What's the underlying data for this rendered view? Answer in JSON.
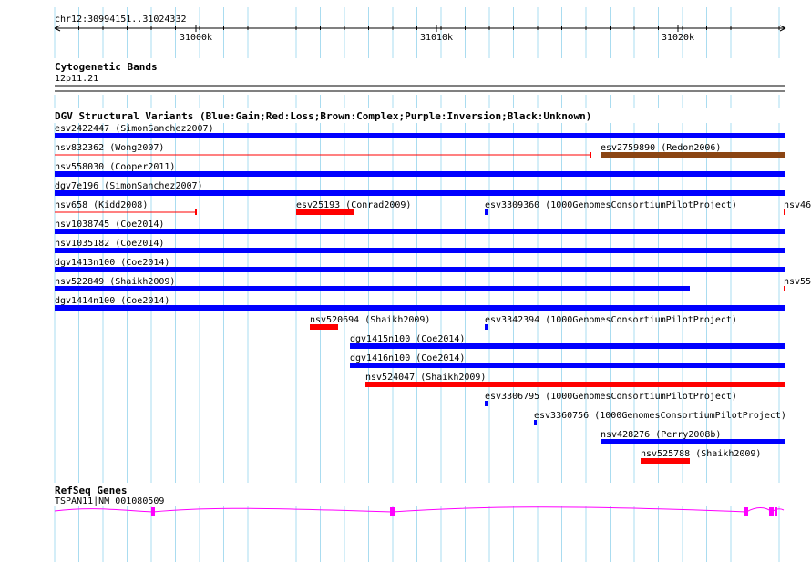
{
  "location": "chr12:30994151..31024332",
  "ruler": {
    "ticks": [
      {
        "label": "31000k"
      },
      {
        "label": "31010k"
      },
      {
        "label": "31020k"
      }
    ]
  },
  "tracks": {
    "cytoband": {
      "title": "Cytogenetic Bands",
      "band": "12p11.21"
    },
    "dgv": {
      "title": "DGV Structural Variants (Blue:Gain;Red:Loss;Brown:Complex;Purple:Inversion;Black:Unknown)",
      "colors": {
        "gain": "#0000ff",
        "loss": "#ff0000",
        "complex": "#8b4513",
        "inversion": "#800080",
        "unknown": "#000000"
      },
      "features": [
        {
          "id": "esv2422447",
          "label": "esv2422447 (SimonSanchez2007)",
          "type": "gain",
          "style": "bar",
          "row": 0
        },
        {
          "id": "nsv832362",
          "label": "nsv832362 (Wong2007)",
          "type": "loss",
          "style": "line",
          "row": 1
        },
        {
          "id": "esv2759890",
          "label": "esv2759890 (Redon2006)",
          "type": "complex",
          "style": "bar",
          "row": 1
        },
        {
          "id": "nsv558030",
          "label": "nsv558030 (Cooper2011)",
          "type": "gain",
          "style": "bar",
          "row": 2
        },
        {
          "id": "dgv7e196",
          "label": "dgv7e196 (SimonSanchez2007)",
          "type": "gain",
          "style": "bar",
          "row": 3
        },
        {
          "id": "nsv658",
          "label": "nsv658 (Kidd2008)",
          "type": "loss",
          "style": "line",
          "row": 4
        },
        {
          "id": "esv25193",
          "label": "esv25193 (Conrad2009)",
          "type": "loss",
          "style": "bar",
          "row": 4
        },
        {
          "id": "esv3309360",
          "label": "esv3309360 (1000GenomesConsortiumPilotProject)",
          "type": "gain",
          "style": "bar",
          "row": 4
        },
        {
          "id": "nsv46",
          "label": "nsv46",
          "type": "loss",
          "style": "bar",
          "row": 4
        },
        {
          "id": "nsv1038745",
          "label": "nsv1038745 (Coe2014)",
          "type": "gain",
          "style": "bar",
          "row": 5
        },
        {
          "id": "nsv1035182",
          "label": "nsv1035182 (Coe2014)",
          "type": "gain",
          "style": "bar",
          "row": 6
        },
        {
          "id": "dgv1413n100",
          "label": "dgv1413n100 (Coe2014)",
          "type": "gain",
          "style": "bar",
          "row": 7
        },
        {
          "id": "nsv522849",
          "label": "nsv522849 (Shaikh2009)",
          "type": "gain",
          "style": "bar",
          "row": 8
        },
        {
          "id": "nsv55",
          "label": "nsv55",
          "type": "loss",
          "style": "bar",
          "row": 8
        },
        {
          "id": "dgv1414n100",
          "label": "dgv1414n100 (Coe2014)",
          "type": "gain",
          "style": "bar",
          "row": 9
        },
        {
          "id": "nsv520694",
          "label": "nsv520694 (Shaikh2009)",
          "type": "loss",
          "style": "bar",
          "row": 10
        },
        {
          "id": "esv3342394",
          "label": "esv3342394 (1000GenomesConsortiumPilotProject)",
          "type": "gain",
          "style": "bar",
          "row": 10
        },
        {
          "id": "dgv1415n100",
          "label": "dgv1415n100 (Coe2014)",
          "type": "gain",
          "style": "bar",
          "row": 11
        },
        {
          "id": "dgv1416n100",
          "label": "dgv1416n100 (Coe2014)",
          "type": "gain",
          "style": "bar",
          "row": 12
        },
        {
          "id": "nsv524047",
          "label": "nsv524047 (Shaikh2009)",
          "type": "loss",
          "style": "bar",
          "row": 13
        },
        {
          "id": "esv3306795",
          "label": "esv3306795 (1000GenomesConsortiumPilotProject)",
          "type": "gain",
          "style": "bar",
          "row": 14
        },
        {
          "id": "esv3360756",
          "label": "esv3360756 (1000GenomesConsortiumPilotProject)",
          "type": "gain",
          "style": "bar",
          "row": 15
        },
        {
          "id": "nsv428276",
          "label": "nsv428276 (Perry2008b)",
          "type": "gain",
          "style": "bar",
          "row": 16
        },
        {
          "id": "nsv525788",
          "label": "nsv525788 (Shaikh2009)",
          "type": "loss",
          "style": "bar",
          "row": 17
        }
      ]
    },
    "refseq": {
      "title": "RefSeq Genes",
      "gene": "TSPAN11|NM_001080509",
      "color": "#ff00ff"
    }
  }
}
